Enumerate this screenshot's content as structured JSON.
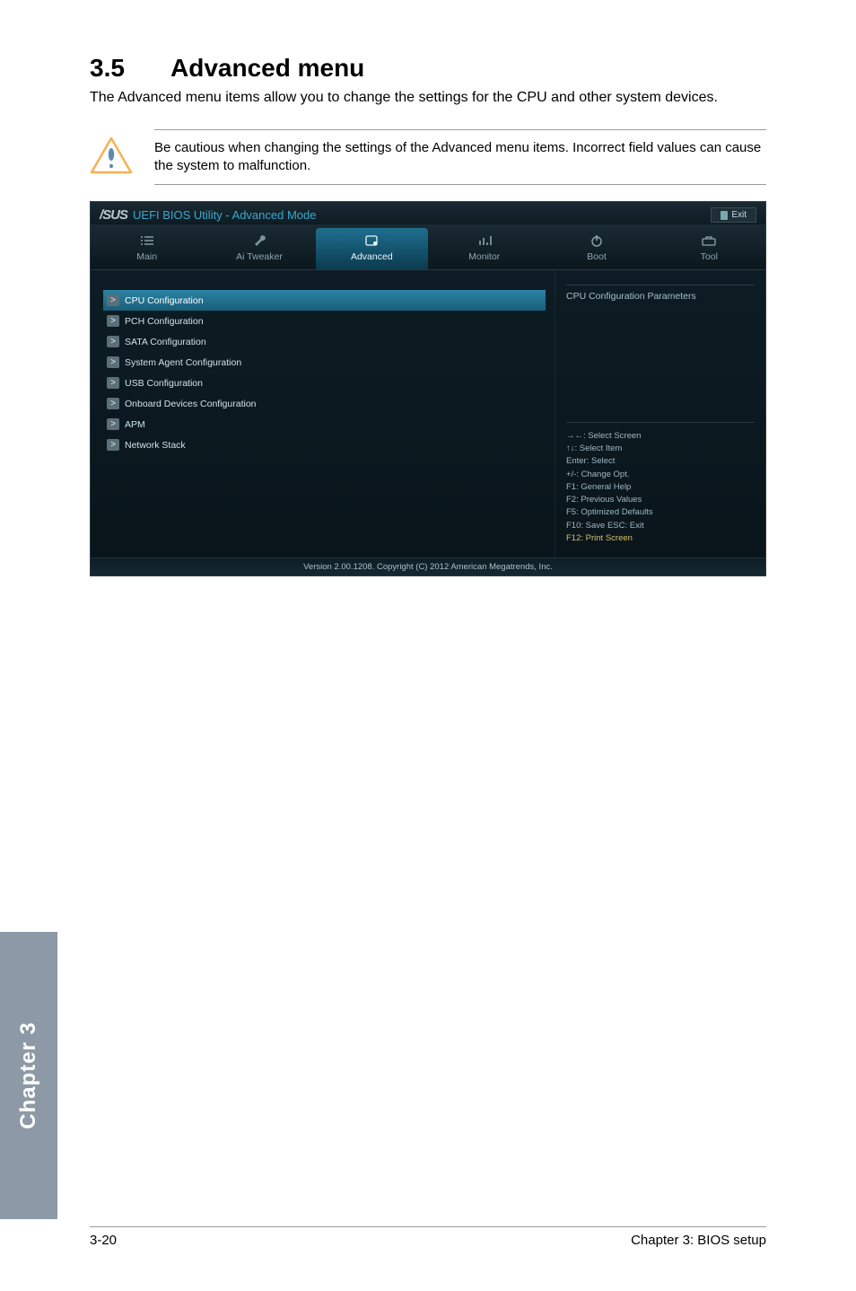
{
  "section": {
    "number": "3.5",
    "title": "Advanced menu",
    "intro": "The Advanced menu items allow you to change the settings for the CPU and other system devices.",
    "warning": "Be cautious when changing the settings of the Advanced menu items. Incorrect field values can cause the system to malfunction."
  },
  "bios": {
    "brand": "/SUS",
    "title": "UEFI BIOS Utility - Advanced Mode",
    "exit_label": "Exit",
    "tabs": [
      {
        "label": "Main"
      },
      {
        "label": "Ai Tweaker"
      },
      {
        "label": "Advanced"
      },
      {
        "label": "Monitor"
      },
      {
        "label": "Boot"
      },
      {
        "label": "Tool"
      }
    ],
    "menu": [
      {
        "label": "CPU Configuration",
        "selected": true
      },
      {
        "label": "PCH Configuration"
      },
      {
        "label": "SATA Configuration"
      },
      {
        "label": "System Agent Configuration"
      },
      {
        "label": "USB Configuration"
      },
      {
        "label": "Onboard Devices Configuration"
      },
      {
        "label": "APM"
      },
      {
        "label": "Network Stack"
      }
    ],
    "right_header": "CPU Configuration Parameters",
    "help": {
      "l1": "→←: Select Screen",
      "l2": "↑↓: Select Item",
      "l3": "Enter: Select",
      "l4": "+/-: Change Opt.",
      "l5": "F1: General Help",
      "l6": "F2: Previous Values",
      "l7": "F5: Optimized Defaults",
      "l8": "F10: Save   ESC: Exit",
      "l9": "F12: Print Screen"
    },
    "footer": "Version 2.00.1208.   Copyright (C) 2012 American Megatrends, Inc."
  },
  "side_tab": "Chapter 3",
  "footer": {
    "left": "3-20",
    "right": "Chapter 3: BIOS setup"
  }
}
